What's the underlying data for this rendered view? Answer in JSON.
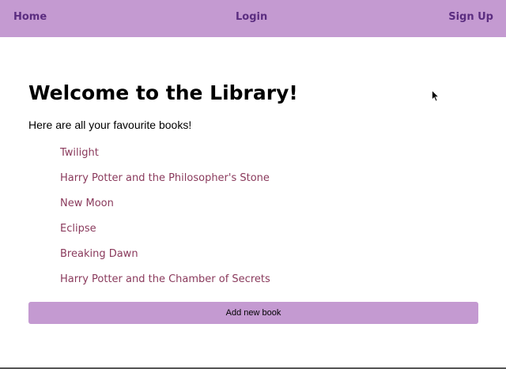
{
  "nav": {
    "home": "Home",
    "login": "Login",
    "signup": "Sign Up"
  },
  "main": {
    "title": "Welcome to the Library!",
    "intro": "Here are all your favourite books!",
    "books": [
      "Twilight",
      "Harry Potter and the Philosopher's Stone",
      "New Moon",
      "Eclipse",
      "Breaking Dawn",
      "Harry Potter and the Chamber of Secrets"
    ],
    "add_button": "Add new book"
  },
  "colors": {
    "navbar": "#c49ad1",
    "nav_link": "#5b2d80",
    "book_link": "#8a3a5c",
    "button": "#c49ad1"
  },
  "icons": {
    "cursor": "mouse-pointer-icon"
  }
}
